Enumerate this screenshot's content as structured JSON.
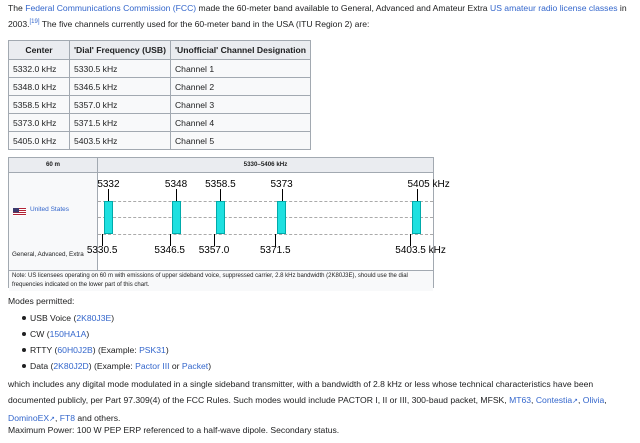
{
  "intro": {
    "t1": "The ",
    "fcc": "Federal Communications Commission (FCC)",
    "t2": " made the 60-meter band available to General, Advanced and Amateur Extra ",
    "lic": "US amateur radio license classes",
    "t3": " in 2003.",
    "ref": "[19]",
    "t4": " The five channels currently used for the 60-meter band in the USA (ITU Region 2) are:"
  },
  "channels": {
    "headers": [
      "Center",
      "'Dial' Frequency (USB)",
      "'Unofficial' Channel Designation"
    ],
    "rows": [
      [
        "5332.0 kHz",
        "5330.5 kHz",
        "Channel 1"
      ],
      [
        "5348.0 kHz",
        "5346.5 kHz",
        "Channel 2"
      ],
      [
        "5358.5 kHz",
        "5357.0 kHz",
        "Channel 3"
      ],
      [
        "5373.0 kHz",
        "5371.5 kHz",
        "Channel 4"
      ],
      [
        "5405.0 kHz",
        "5403.5 kHz",
        "Channel 5"
      ]
    ]
  },
  "chart": {
    "band": "60 m",
    "range": "5330–5406 kHz",
    "country": "United States",
    "classes": "General, Advanced, Extra",
    "note": "Note: US licensees operating on 60 m with emissions of upper sideband voice, suppressed carrier, 2.8 kHz bandwidth (2K80J3E), should use the dial frequencies indicated on the lower part of this chart.",
    "colors": {
      "channel": "#1ee0e0"
    }
  },
  "chart_data": {
    "type": "bar",
    "title": "",
    "xlabel": "",
    "ylabel": "",
    "xlim": [
      5330,
      5406
    ],
    "center_labels": [
      "5332",
      "5348",
      "5358.5",
      "5373",
      "5405 kHz"
    ],
    "dial_labels": [
      "5330.5",
      "5346.5",
      "5357.0",
      "5371.5",
      "5403.5 kHz"
    ],
    "centers": [
      5332.0,
      5348.0,
      5358.5,
      5373.0,
      5405.0
    ],
    "dial": [
      5330.5,
      5346.5,
      5357.0,
      5371.5,
      5403.5
    ],
    "bandwidth_khz": 2.8
  },
  "modes": {
    "heading": "Modes permitted:",
    "items": [
      {
        "name": "USB Voice (",
        "code": "2K80J3E",
        "close": ")",
        "extra": ""
      },
      {
        "name": "CW (",
        "code": "150HA1A",
        "close": ")",
        "extra": ""
      },
      {
        "name": "RTTY (",
        "code": "60H0J2B",
        "close": ") (Example: ",
        "link": "PSK31",
        "end": ")"
      },
      {
        "name": "Data (",
        "code": "2K80J2D",
        "close": ") (Example: ",
        "link": "Pactor III",
        "mid": " or ",
        "link2": "Packet",
        "end": ")"
      }
    ]
  },
  "which": {
    "t1": "which includes any digital mode modulated in a single sideband transmitter, with a bandwidth of 2.8 kHz or less whose technical characteristics have been documented publicly, per Part 97.309(4) of the FCC Rules. Such modes would include PACTOR I, II or III, 300-baud packet, MFSK, ",
    "mt63": "MT63",
    "sep1": ", ",
    "contestia": "Contestia",
    "sep2": ", ",
    "olivia": "Olivia",
    "sep3": ", ",
    "domino": "DominoEX",
    "sep4": ", ",
    "ft8": "FT8",
    "t2": " and others."
  },
  "maxpower": "Maximum Power: 100 W PEP ERP referenced to a half-wave dipole. Secondary status."
}
